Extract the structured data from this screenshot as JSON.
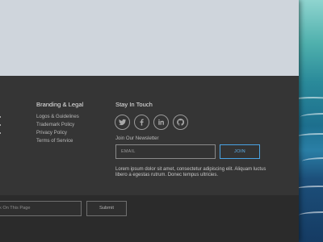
{
  "footer": {
    "branding": {
      "title": "Branding & Legal",
      "links": [
        "Logos & Guidelines",
        "Trademark Policy",
        "Privacy Policy",
        "Terms of Service"
      ]
    },
    "stay_in_touch": {
      "title": "Stay In Touch",
      "social": [
        "twitter-icon",
        "facebook-icon",
        "linkedin-icon",
        "github-icon"
      ]
    },
    "newsletter": {
      "label": "Join Our Newsletter",
      "email_placeholder": "EMAIL",
      "join_label": "JOIN",
      "description": "Lorem ipsum dolor sit amet, consectetur adipiscing elit. Aliquam luctus libero a egestas rutrum. Donec tempus ultricies."
    }
  },
  "bottom_bar": {
    "feedback_placeholder": "k On This Page",
    "submit_label": "Submit"
  },
  "colors": {
    "footer_bg": "#353535",
    "accent": "#4aa3e3",
    "hero_bg": "#cfd5dc"
  }
}
